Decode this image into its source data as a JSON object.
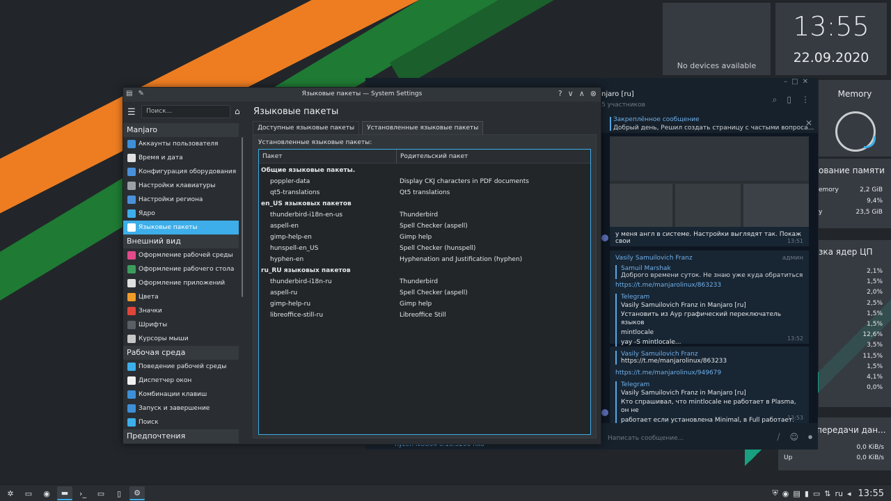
{
  "widgets": {
    "devices": "No devices available",
    "clock_time": "13:55",
    "clock_date": "22.09.2020",
    "memory_title": "Memory",
    "mem_usage_title": "ование памяти",
    "mem_rows": [
      {
        "label": "emory",
        "value": "2,2 GiB"
      },
      {
        "label": "",
        "value": "9,4%"
      },
      {
        "label": "y",
        "value": "23,5 GiB"
      }
    ],
    "cpu_title": "зка ядер ЦП",
    "cpu_values": [
      "2,1%",
      "1,5%",
      "2,0%",
      "2,5%",
      "1,5%",
      "1,5%",
      "12,6%",
      "3,5%",
      "11,5%",
      "1,5%",
      "4,1%",
      "0,0%"
    ],
    "net_title": "передачи дан...",
    "net_rows": [
      {
        "label": "Down",
        "value": "0,0 KiB/s"
      },
      {
        "label": "Up",
        "value": "0,0 KiB/s"
      }
    ]
  },
  "telegram": {
    "chat_name": "njaro [ru]",
    "chat_sub": "5 участников",
    "pinned_label": "Закреплённое сообщение",
    "pinned_text": "Добрый день, Решил создать страницу с частыми вопроса...",
    "msg1_text": "у меня англ в системе. Настройки выглядят так. Покаж свои",
    "msg1_time": "13:51",
    "msg2_author": "Vasily Samuilovich Franz",
    "msg2_role": "админ",
    "msg2_reply_who": "Samuil Marshak",
    "msg2_reply_text": "Доброго времени суток. Не знаю уже куда обратиться. Реш...",
    "msg2_link": "https://t.me/manjarolinux/863233",
    "msg2_fwd_src": "Telegram",
    "msg2_fwd_who": "Vasily Samuilovich Franz in Manjaro [ru]",
    "msg2_fwd_body1": "Установить из Аур графический переключатель языков",
    "msg2_fwd_body2": "mintlocale",
    "msg2_fwd_body3": "yay -S mintlocale...",
    "msg2_time": "13:52",
    "msg3_reply_who": "Vasily Samuilovich Franz",
    "msg3_reply_text": "https://t.me/manjarolinux/863233",
    "msg3_link": "https://t.me/manjarolinux/949679",
    "msg3_fwd_src": "Telegram",
    "msg3_fwd_who": "Vasily Samuilovich Franz in Manjaro [ru]",
    "msg3_fwd_body1": "Кто спрашивал, что mintlocale не работает в Plasma, он не",
    "msg3_fwd_body2": "работает если установлена Minimal, в Full работает.",
    "msg3_time": "13:53",
    "input_placeholder": "Написать сообщение...",
    "underlay_text": "Ryzen NO864 6.10.5200 nxo"
  },
  "settings": {
    "window_title": "Языковые пакеты — System Settings",
    "search_placeholder": "Поиск...",
    "sidebar": [
      {
        "type": "cat",
        "label": "Manjaro"
      },
      {
        "type": "item",
        "label": "Аккаунты пользователя",
        "color": "#3d8fd6"
      },
      {
        "type": "item",
        "label": "Время и дата",
        "color": "#e0e0e0"
      },
      {
        "type": "item",
        "label": "Конфигурация оборудования",
        "color": "#4a90d9"
      },
      {
        "type": "item",
        "label": "Настройки клавиатуры",
        "color": "#9aa0a6"
      },
      {
        "type": "item",
        "label": "Настройки региона",
        "color": "#4a90d9"
      },
      {
        "type": "item",
        "label": "Ядро",
        "color": "#3daee9"
      },
      {
        "type": "item",
        "label": "Языковые пакеты",
        "color": "#ffffff",
        "active": true
      },
      {
        "type": "cat",
        "label": "Внешний вид"
      },
      {
        "type": "item",
        "label": "Оформление рабочей среды",
        "color": "#e24a8c"
      },
      {
        "type": "item",
        "label": "Оформление рабочего стола",
        "color": "#3b9c5c"
      },
      {
        "type": "item",
        "label": "Оформление приложений",
        "color": "#e0e0e0"
      },
      {
        "type": "item",
        "label": "Цвета",
        "color": "#f09b2a"
      },
      {
        "type": "item",
        "label": "Значки",
        "color": "#e0453a"
      },
      {
        "type": "item",
        "label": "Шрифты",
        "color": "#5a5f66"
      },
      {
        "type": "item",
        "label": "Курсоры мыши",
        "color": "#c7c7c7"
      },
      {
        "type": "cat",
        "label": "Рабочая среда"
      },
      {
        "type": "item",
        "label": "Поведение рабочей среды",
        "color": "#3daee9"
      },
      {
        "type": "item",
        "label": "Диспетчер окон",
        "color": "#f0f0f0"
      },
      {
        "type": "item",
        "label": "Комбинации клавиш",
        "color": "#3d8fd6"
      },
      {
        "type": "item",
        "label": "Запуск и завершение",
        "color": "#3d8fd6"
      },
      {
        "type": "item",
        "label": "Поиск",
        "color": "#3daee9"
      },
      {
        "type": "cat",
        "label": "Предпочтения пользователя"
      }
    ],
    "page_heading": "Языковые пакеты",
    "tabs": [
      {
        "label": "Доступные языковые пакеты",
        "active": false
      },
      {
        "label": "Установленные языковые пакеты",
        "active": true
      }
    ],
    "panel_label": "Установленные языковые пакеты:",
    "columns": [
      "Пакет",
      "Родительский пакет"
    ],
    "rows": [
      {
        "type": "group",
        "name": "Общие языковые пакеты.",
        "parent": ""
      },
      {
        "type": "leaf",
        "name": "poppler-data",
        "parent": "Display CKJ characters in PDF documents"
      },
      {
        "type": "leaf",
        "name": "qt5-translations",
        "parent": "Qt5 translations"
      },
      {
        "type": "group",
        "name": "en_US языковых пакетов",
        "parent": ""
      },
      {
        "type": "leaf",
        "name": "thunderbird-i18n-en-us",
        "parent": "Thunderbird"
      },
      {
        "type": "leaf",
        "name": "aspell-en",
        "parent": "Spell Checker (aspell)"
      },
      {
        "type": "leaf",
        "name": "gimp-help-en",
        "parent": "Gimp help"
      },
      {
        "type": "leaf",
        "name": "hunspell-en_US",
        "parent": "Spell Checker (hunspell)"
      },
      {
        "type": "leaf",
        "name": "hyphen-en",
        "parent": "Hyphenation and Justification (hyphen)"
      },
      {
        "type": "group",
        "name": "ru_RU языковых пакетов",
        "parent": ""
      },
      {
        "type": "leaf",
        "name": "thunderbird-i18n-ru",
        "parent": "Thunderbird"
      },
      {
        "type": "leaf",
        "name": "aspell-ru",
        "parent": "Spell Checker (aspell)"
      },
      {
        "type": "leaf",
        "name": "gimp-help-ru",
        "parent": "Gimp help"
      },
      {
        "type": "leaf",
        "name": "libreoffice-still-ru",
        "parent": "Libreoffice Still"
      }
    ]
  },
  "taskbar": {
    "layout": "ru",
    "clock": "13:55"
  }
}
